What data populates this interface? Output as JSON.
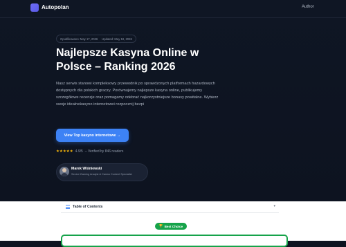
{
  "header": {
    "brand": "Autopolan",
    "nav_author": "Author"
  },
  "meta": {
    "published": "Opublikowano: May 17, 2026",
    "updated": "Updated: May 18, 2026"
  },
  "hero": {
    "title": "Najlepsze Kasyna Online w Polsce – Ranking 2026",
    "description": "Nasz serwis stanowi kompleksowy przewodnik po sprawdzonych platformach hazardowych dostępnych dla polskich graczy. Porównujemy najlepsze kasyna online, publikujemy szczegółowe recenzje oraz pomagamy odebrać najkorzystniejsze bonusy powitalne. Wybierz swoje idealnekasyno internetowei rozpocznij bezpi",
    "cta_label": "View Top kasyno internetowe →",
    "stars": "★★★★★",
    "rating": "4.9/5",
    "verified": "– Verified by 846 readers"
  },
  "author": {
    "name": "Marek Wiśniewski",
    "role": "Senior iGaming Analyst & Casino Content Specialist"
  },
  "toc": {
    "label": "Table of Contents",
    "chevron": "▾"
  },
  "badge": {
    "icon": "🏆",
    "label": "Best Choice"
  },
  "colors": {
    "accent": "#3d82f5",
    "badge_green": "#16a34a",
    "star": "#f5b50a",
    "hero_bg": "#0e1421"
  }
}
